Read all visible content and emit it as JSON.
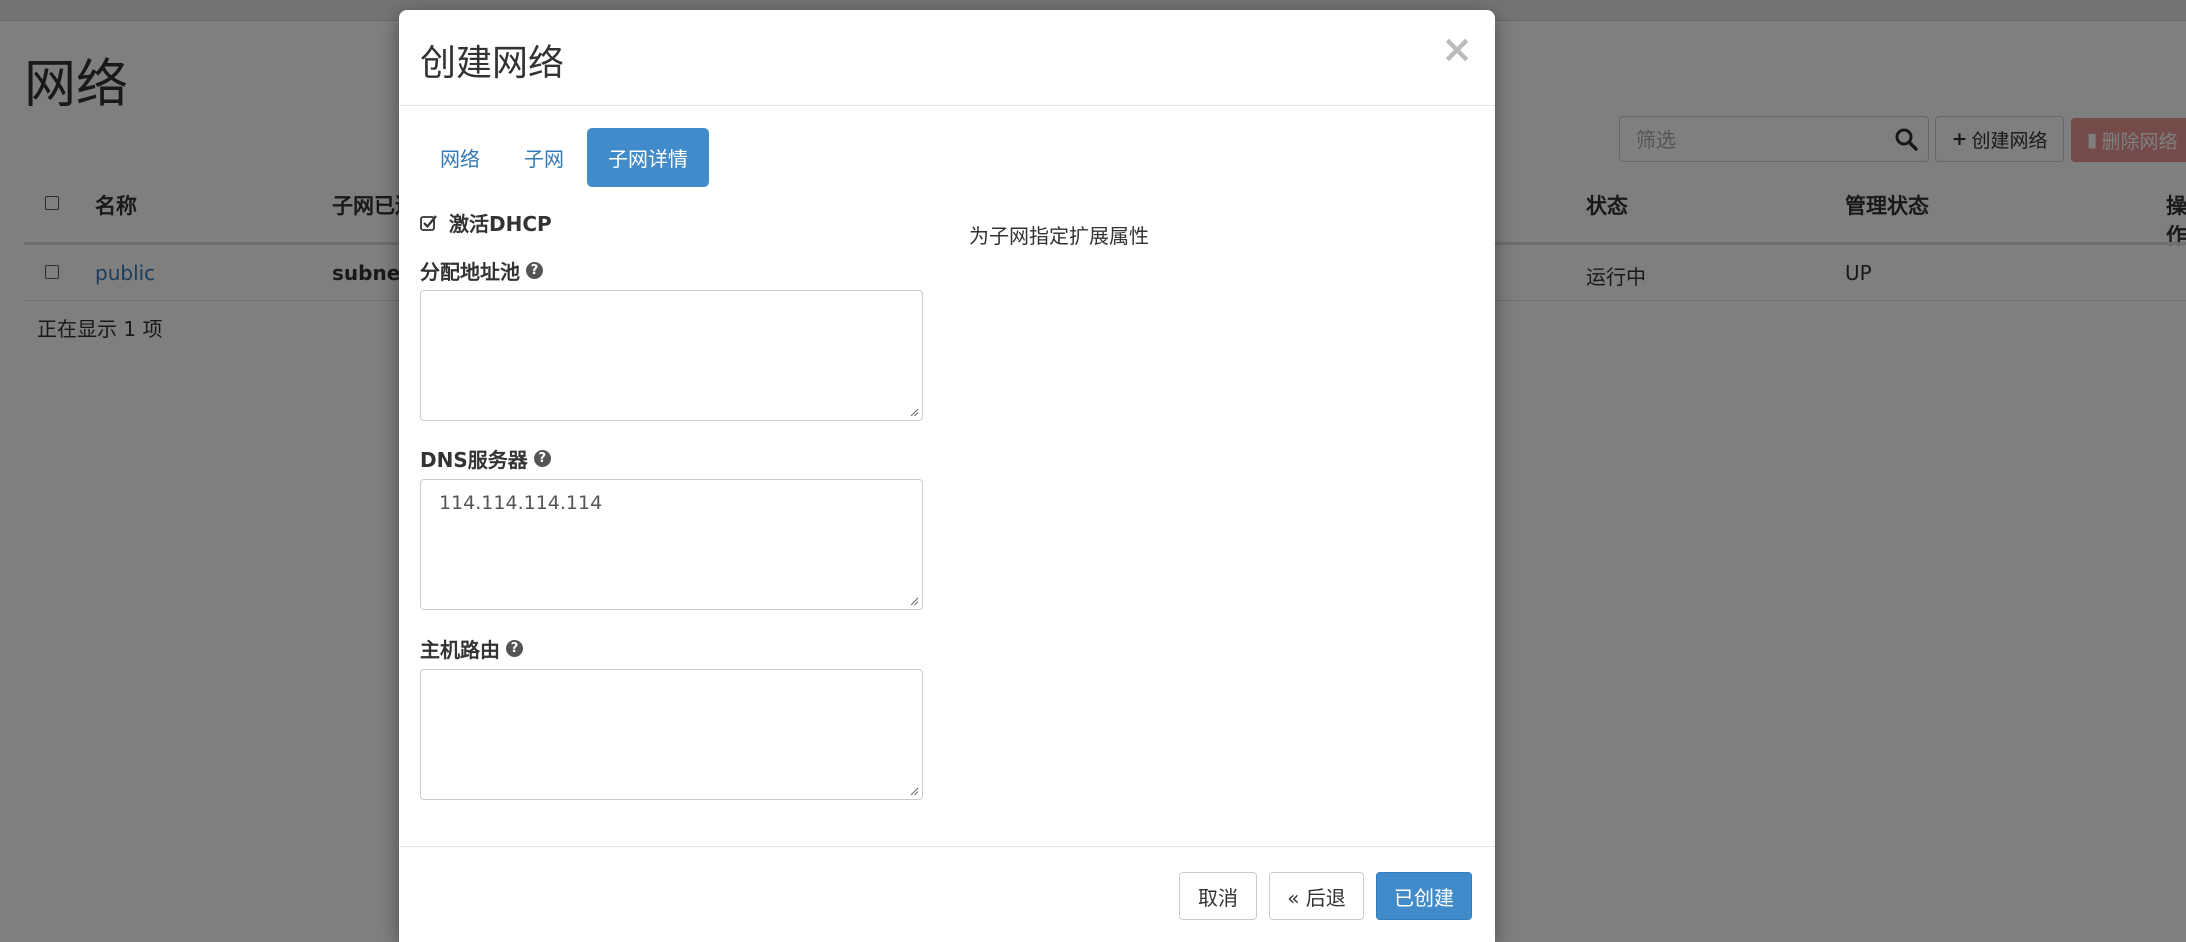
{
  "page": {
    "title": "网络",
    "filter_placeholder": "筛选",
    "create_network_label": "创建网络",
    "delete_network_label": "删除网络",
    "columns": [
      "名称",
      "子网已连",
      "状态",
      "管理状态",
      "操作"
    ],
    "rows": [
      {
        "name": "public",
        "subnet": "subnet",
        "status": "运行中",
        "admin_state": "UP"
      }
    ],
    "count_text": "正在显示 1 项"
  },
  "modal": {
    "title": "创建网络",
    "close_symbol": "×",
    "tabs": [
      {
        "label": "网络",
        "active": false
      },
      {
        "label": "子网",
        "active": false
      },
      {
        "label": "子网详情",
        "active": true
      }
    ],
    "dhcp_label": "激活DHCP",
    "dhcp_checked": true,
    "fields": {
      "allocation_pools": {
        "label": "分配地址池",
        "value": ""
      },
      "dns_servers": {
        "label": "DNS服务器",
        "value": "114.114.114.114"
      },
      "host_routes": {
        "label": "主机路由",
        "value": ""
      }
    },
    "side_description": "为子网指定扩展属性",
    "buttons": {
      "cancel": "取消",
      "back": "« 后退",
      "create": "已创建"
    }
  },
  "colors": {
    "primary": "#428bca",
    "link": "#337ab7",
    "danger": "#d9534f"
  }
}
